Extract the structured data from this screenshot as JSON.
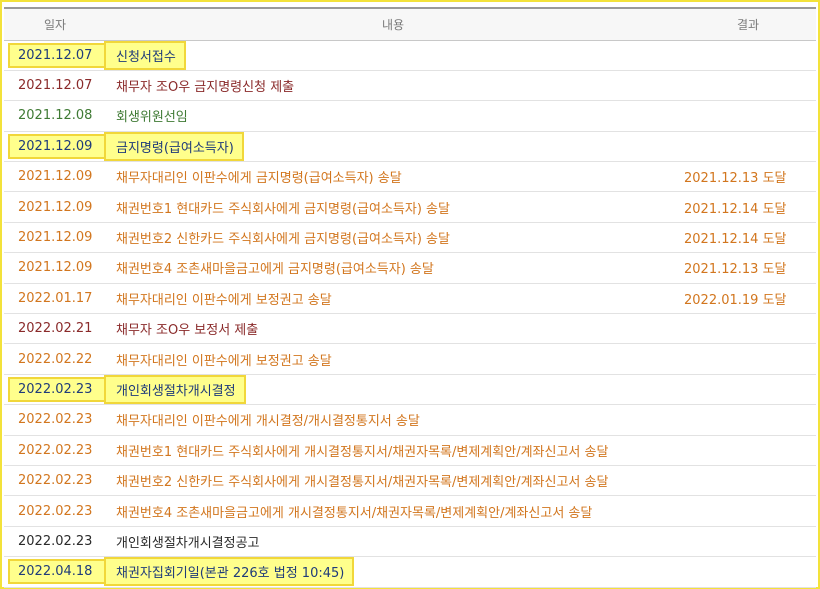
{
  "table": {
    "headers": {
      "date": "일자",
      "content": "내용",
      "result": "결과"
    },
    "rows": [
      {
        "date": "2021.12.07",
        "content": "신청서접수",
        "result": "",
        "highlight": true
      },
      {
        "date": "2021.12.07",
        "content": "채무자 조O우 금지명령신청 제출",
        "result": "",
        "highlight": false
      },
      {
        "date": "2021.12.08",
        "content": "회생위원선임",
        "result": "",
        "highlight": false
      },
      {
        "date": "2021.12.09",
        "content": "금지명령(급여소득자)",
        "result": "",
        "highlight": true
      },
      {
        "date": "2021.12.09",
        "content": "채무자대리인 이판수에게 금지명령(급여소득자) 송달",
        "result": "2021.12.13 도달",
        "highlight": false
      },
      {
        "date": "2021.12.09",
        "content": "채권번호1 현대카드 주식회사에게 금지명령(급여소득자) 송달",
        "result": "2021.12.14 도달",
        "highlight": false
      },
      {
        "date": "2021.12.09",
        "content": "채권번호2 신한카드 주식회사에게 금지명령(급여소득자) 송달",
        "result": "2021.12.14 도달",
        "highlight": false
      },
      {
        "date": "2021.12.09",
        "content": "채권번호4 조촌새마을금고에게 금지명령(급여소득자) 송달",
        "result": "2021.12.13 도달",
        "highlight": false
      },
      {
        "date": "2022.01.17",
        "content": "채무자대리인 이판수에게 보정권고 송달",
        "result": "2022.01.19 도달",
        "highlight": false
      },
      {
        "date": "2022.02.21",
        "content": "채무자 조O우 보정서 제출",
        "result": "",
        "highlight": false
      },
      {
        "date": "2022.02.22",
        "content": "채무자대리인 이판수에게 보정권고 송달",
        "result": "",
        "highlight": false
      },
      {
        "date": "2022.02.23",
        "content": "개인회생절차개시결정",
        "result": "",
        "highlight": true
      },
      {
        "date": "2022.02.23",
        "content": "채무자대리인 이판수에게 개시결정/개시결정통지서 송달",
        "result": "",
        "highlight": false
      },
      {
        "date": "2022.02.23",
        "content": "채권번호1 현대카드 주식회사에게 개시결정통지서/채권자목록/변제계획안/계좌신고서 송달",
        "result": "",
        "highlight": false
      },
      {
        "date": "2022.02.23",
        "content": "채권번호2 신한카드 주식회사에게 개시결정통지서/채권자목록/변제계획안/계좌신고서 송달",
        "result": "",
        "highlight": false
      },
      {
        "date": "2022.02.23",
        "content": "채권번호4 조촌새마을금고에게 개시결정통지서/채권자목록/변제계획안/계좌신고서 송달",
        "result": "",
        "highlight": false
      },
      {
        "date": "2022.02.23",
        "content": "개인회생절차개시결정공고",
        "result": "",
        "highlight": false
      },
      {
        "date": "2022.04.18",
        "content": "채권자집회기일(본관 226호 법정 10:45)",
        "result": "",
        "highlight": true
      }
    ]
  },
  "colors": {
    "highlight_bg": "#ffff8c",
    "highlight_border": "#f1d73a",
    "delivery_text": "#d2761e",
    "submission_text": "#8a2a2a",
    "appointment_text": "#3f7a34",
    "notice_text": "#2a2a2a",
    "highlight_text": "#1f3b7a"
  }
}
